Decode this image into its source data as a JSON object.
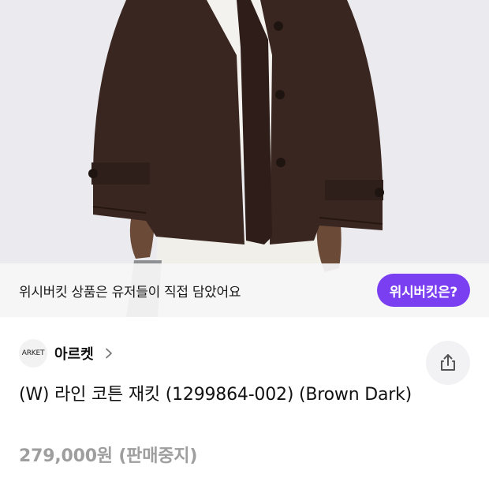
{
  "banner": {
    "text": "위시버킷 상품은 유저들이 직접 담았어요",
    "button_label": "위시버킷은?"
  },
  "brand": {
    "logo_text": "ARKET",
    "name": "아르켓"
  },
  "product": {
    "title": "(W) 라인 코튼 재킷 (1299864-002) (Brown Dark)",
    "price": "279,000원",
    "status": "(판매중지)"
  },
  "icons": {
    "chevron": "chevron-right-icon",
    "share": "share-icon"
  },
  "colors": {
    "accent": "#7b3ff2",
    "price": "#9e9e9e",
    "jacket": "#3a2620"
  }
}
